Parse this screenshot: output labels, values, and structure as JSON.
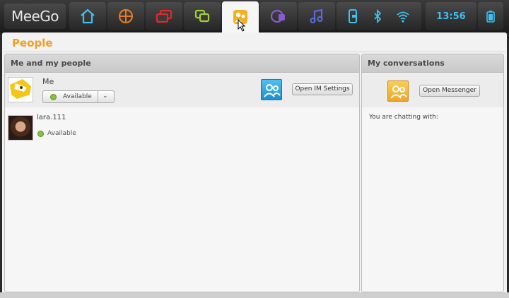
{
  "taskbar": {
    "brand": "MeeGo",
    "zones": [
      {
        "name": "home-zone",
        "icon": "home-icon",
        "color": "#3ec0f0"
      },
      {
        "name": "applications-zone",
        "icon": "applications-icon",
        "color": "#e07a28"
      },
      {
        "name": "zones-zone",
        "icon": "zones-icon",
        "color": "#e02a2a"
      },
      {
        "name": "status-zone",
        "icon": "status-icon",
        "color": "#9fcf3a"
      },
      {
        "name": "people-zone",
        "icon": "people-icon",
        "color": "#f0b020",
        "active": true
      },
      {
        "name": "internet-zone",
        "icon": "internet-icon",
        "color": "#8a5ad0"
      },
      {
        "name": "media-zone",
        "icon": "music-icon",
        "color": "#5a6ad8"
      }
    ],
    "status_icons": [
      "device-icon",
      "bluetooth-icon",
      "wifi-icon",
      "battery-icon"
    ],
    "time": "13:56"
  },
  "app": {
    "title": "People",
    "left_panel": {
      "header": "Me and my people",
      "me": {
        "name": "Me",
        "presence": "Available",
        "im_settings_button": "Open IM Settings"
      },
      "contacts": [
        {
          "name": "lara.111",
          "status": "Available"
        }
      ]
    },
    "right_panel": {
      "header": "My conversations",
      "messenger_button": "Open Messenger",
      "chatting_label": "You are chatting with:"
    }
  }
}
